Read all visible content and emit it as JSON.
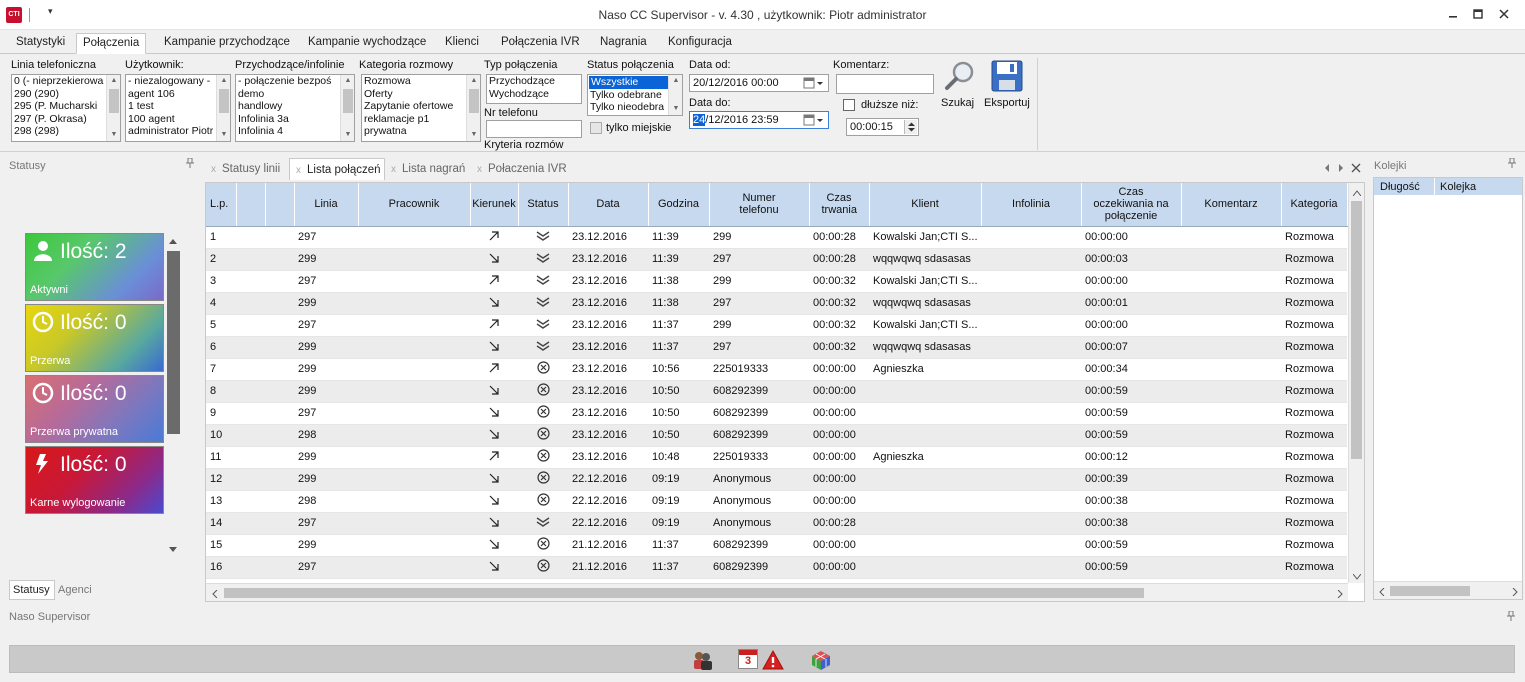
{
  "app": {
    "logo_text": "CTI",
    "title": "Naso CC Supervisor - v. 4.30 , użytkownik: Piotr administrator",
    "qa_arrow": "▾"
  },
  "menu": {
    "tabs": [
      "Statystyki",
      "Połączenia",
      "Kampanie przychodzące",
      "Kampanie wychodzące",
      "Klienci",
      "Połączenia IVR",
      "Nagrania",
      "Konfiguracja"
    ],
    "active": "Połączenia"
  },
  "filters": {
    "line": {
      "label": "Linia telefoniczna",
      "items": [
        "0 (- nieprzekierowa",
        "290 (290)",
        "295 (P. Mucharski",
        "297 (P. Okrasa)",
        "298 (298)"
      ]
    },
    "user": {
      "label": "Użytkownik:",
      "items": [
        "- niezalogowany -",
        " agent 106",
        "1 test",
        "100 agent",
        "administrator Piotr"
      ]
    },
    "incoming": {
      "label": "Przychodzące/infolinie",
      "items": [
        "- połączenie bezpoś",
        "demo",
        "handlowy",
        "Infolinia 3a",
        "Infolinia 4"
      ]
    },
    "category": {
      "label": "Kategoria rozmowy",
      "items": [
        "Rozmowa",
        "Oferty",
        "Zapytanie ofertowe",
        "reklamacje p1",
        "prywatna"
      ]
    },
    "call_type": {
      "label": "Typ połączenia",
      "items": [
        "Przychodzące",
        "Wychodzące"
      ]
    },
    "call_status": {
      "label": "Status połączenia",
      "items": [
        "Wszystkie",
        "Tylko odebrane",
        "Tylko nieodebra"
      ],
      "selected": "Wszystkie"
    },
    "phone_label": "Nr telefonu",
    "phone_value": "",
    "local_only_label": "tylko miejskie",
    "date_from_label": "Data od:",
    "date_from_value": "20/12/2016  00:00",
    "date_to_label": "Data do:",
    "date_to_day": "24",
    "date_to_rest": "/12/2016  23:59",
    "comment_label": "Komentarz:",
    "comment_value": "",
    "longer_label": "dłuższe niż:",
    "duration_value": "00:00:15",
    "criteria_label": "Kryteria rozmów",
    "search_label": "Szukaj",
    "export_label": "Eksportuj"
  },
  "left": {
    "title": "Statusy",
    "pin": "ᵖ",
    "tiles": [
      {
        "count": "Ilość: 2",
        "caption": "Aktywni",
        "icon": "person-icon"
      },
      {
        "count": "Ilość: 0",
        "caption": "Przerwa",
        "icon": "clock-icon"
      },
      {
        "count": "Ilość: 0",
        "caption": "Przerwa prywatna",
        "icon": "clock-icon"
      },
      {
        "count": "Ilość: 0",
        "caption": "Karne wylogowanie",
        "icon": "lightning-icon"
      }
    ],
    "bottom_tabs": [
      "Statusy",
      "Agenci"
    ]
  },
  "doc_tabs": [
    "Statusy linii",
    "Lista połączeń",
    "Lista nagrań",
    "Połaczenia IVR"
  ],
  "doc_tab_active": "Lista połączeń",
  "grid": {
    "columns": [
      "L.p.",
      "",
      "",
      "Linia",
      "Pracownik",
      "Kierunek",
      "Status",
      "Data",
      "Godzina",
      "Numer telefonu",
      "Czas trwania",
      "Klient",
      "Infolinia",
      "Czas oczekiwania na połączenie",
      "Komentarz",
      "Kategoria"
    ],
    "rows": [
      {
        "lp": "1",
        "linia": "297",
        "kier": "out",
        "status": "ok",
        "data": "23.12.2016",
        "godz": "11:39",
        "numer": "299",
        "czas": "00:00:28",
        "klient": "Kowalski Jan;CTI S...",
        "ocz": "00:00:00",
        "kat": "Rozmowa"
      },
      {
        "lp": "2",
        "linia": "299",
        "kier": "in",
        "status": "ok",
        "data": "23.12.2016",
        "godz": "11:39",
        "numer": "297",
        "czas": "00:00:28",
        "klient": "wqqwqwq sdasasas",
        "ocz": "00:00:03",
        "kat": "Rozmowa"
      },
      {
        "lp": "3",
        "linia": "297",
        "kier": "out",
        "status": "ok",
        "data": "23.12.2016",
        "godz": "11:38",
        "numer": "299",
        "czas": "00:00:32",
        "klient": "Kowalski Jan;CTI S...",
        "ocz": "00:00:00",
        "kat": "Rozmowa"
      },
      {
        "lp": "4",
        "linia": "299",
        "kier": "in",
        "status": "ok",
        "data": "23.12.2016",
        "godz": "11:38",
        "numer": "297",
        "czas": "00:00:32",
        "klient": "wqqwqwq sdasasas",
        "ocz": "00:00:01",
        "kat": "Rozmowa"
      },
      {
        "lp": "5",
        "linia": "297",
        "kier": "out",
        "status": "ok",
        "data": "23.12.2016",
        "godz": "11:37",
        "numer": "299",
        "czas": "00:00:32",
        "klient": "Kowalski Jan;CTI S...",
        "ocz": "00:00:00",
        "kat": "Rozmowa"
      },
      {
        "lp": "6",
        "linia": "299",
        "kier": "in",
        "status": "ok",
        "data": "23.12.2016",
        "godz": "11:37",
        "numer": "297",
        "czas": "00:00:32",
        "klient": "wqqwqwq sdasasas",
        "ocz": "00:00:07",
        "kat": "Rozmowa"
      },
      {
        "lp": "7",
        "linia": "299",
        "kier": "out",
        "status": "x",
        "data": "23.12.2016",
        "godz": "10:56",
        "numer": "225019333",
        "czas": "00:00:00",
        "klient": " Agnieszka",
        "ocz": "00:00:34",
        "kat": "Rozmowa"
      },
      {
        "lp": "8",
        "linia": "299",
        "kier": "in",
        "status": "x",
        "data": "23.12.2016",
        "godz": "10:50",
        "numer": "608292399",
        "czas": "00:00:00",
        "klient": "",
        "ocz": "00:00:59",
        "kat": "Rozmowa"
      },
      {
        "lp": "9",
        "linia": "297",
        "kier": "in",
        "status": "x",
        "data": "23.12.2016",
        "godz": "10:50",
        "numer": "608292399",
        "czas": "00:00:00",
        "klient": "",
        "ocz": "00:00:59",
        "kat": "Rozmowa"
      },
      {
        "lp": "10",
        "linia": "298",
        "kier": "in",
        "status": "x",
        "data": "23.12.2016",
        "godz": "10:50",
        "numer": "608292399",
        "czas": "00:00:00",
        "klient": "",
        "ocz": "00:00:59",
        "kat": "Rozmowa"
      },
      {
        "lp": "11",
        "linia": "299",
        "kier": "out",
        "status": "x",
        "data": "23.12.2016",
        "godz": "10:48",
        "numer": "225019333",
        "czas": "00:00:00",
        "klient": " Agnieszka",
        "ocz": "00:00:12",
        "kat": "Rozmowa"
      },
      {
        "lp": "12",
        "linia": "299",
        "kier": "in",
        "status": "x",
        "data": "22.12.2016",
        "godz": "09:19",
        "numer": "Anonymous",
        "czas": "00:00:00",
        "klient": "",
        "ocz": "00:00:39",
        "kat": "Rozmowa"
      },
      {
        "lp": "13",
        "linia": "298",
        "kier": "in",
        "status": "x",
        "data": "22.12.2016",
        "godz": "09:19",
        "numer": "Anonymous",
        "czas": "00:00:00",
        "klient": "",
        "ocz": "00:00:38",
        "kat": "Rozmowa"
      },
      {
        "lp": "14",
        "linia": "297",
        "kier": "in",
        "status": "ok",
        "data": "22.12.2016",
        "godz": "09:19",
        "numer": "Anonymous",
        "czas": "00:00:28",
        "klient": "",
        "ocz": "00:00:38",
        "kat": "Rozmowa"
      },
      {
        "lp": "15",
        "linia": "299",
        "kier": "in",
        "status": "x",
        "data": "21.12.2016",
        "godz": "11:37",
        "numer": "608292399",
        "czas": "00:00:00",
        "klient": "",
        "ocz": "00:00:59",
        "kat": "Rozmowa"
      },
      {
        "lp": "16",
        "linia": "297",
        "kier": "in",
        "status": "x",
        "data": "21.12.2016",
        "godz": "11:37",
        "numer": "608292399",
        "czas": "00:00:00",
        "klient": "",
        "ocz": "00:00:59",
        "kat": "Rozmowa"
      }
    ]
  },
  "right": {
    "title": "Kolejki",
    "columns": [
      "Długość",
      "Kolejka"
    ]
  },
  "status": {
    "label": "Naso Supervisor",
    "calendar_day": "3"
  },
  "colors": {
    "header_blue": "#c7d9ee",
    "selection": "#0a64d8",
    "accent_red": "#c8102e"
  }
}
